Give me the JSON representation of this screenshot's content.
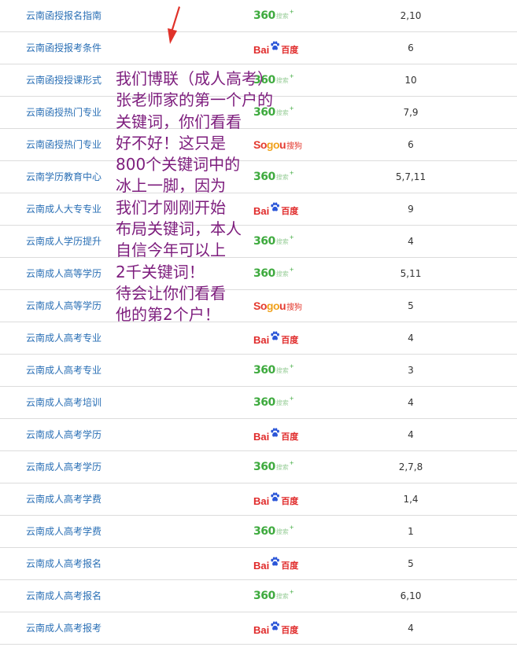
{
  "rows": [
    {
      "keyword": "云南函授报名指南",
      "engine": "360",
      "rank": "2,10"
    },
    {
      "keyword": "云南函授报考条件",
      "engine": "baidu",
      "rank": "6"
    },
    {
      "keyword": "云南函授授课形式",
      "engine": "360",
      "rank": "10"
    },
    {
      "keyword": "云南函授热门专业",
      "engine": "360",
      "rank": "7,9"
    },
    {
      "keyword": "云南函授热门专业",
      "engine": "sogou",
      "rank": "6"
    },
    {
      "keyword": "云南学历教育中心",
      "engine": "360",
      "rank": "5,7,11"
    },
    {
      "keyword": "云南成人大专专业",
      "engine": "baidu",
      "rank": "9"
    },
    {
      "keyword": "云南成人学历提升",
      "engine": "360",
      "rank": "4"
    },
    {
      "keyword": "云南成人高等学历",
      "engine": "360",
      "rank": "5,11"
    },
    {
      "keyword": "云南成人高等学历",
      "engine": "sogou",
      "rank": "5"
    },
    {
      "keyword": "云南成人高考专业",
      "engine": "baidu",
      "rank": "4"
    },
    {
      "keyword": "云南成人高考专业",
      "engine": "360",
      "rank": "3"
    },
    {
      "keyword": "云南成人高考培训",
      "engine": "360",
      "rank": "4"
    },
    {
      "keyword": "云南成人高考学历",
      "engine": "baidu",
      "rank": "4"
    },
    {
      "keyword": "云南成人高考学历",
      "engine": "360",
      "rank": "2,7,8"
    },
    {
      "keyword": "云南成人高考学费",
      "engine": "baidu",
      "rank": "1,4"
    },
    {
      "keyword": "云南成人高考学费",
      "engine": "360",
      "rank": "1"
    },
    {
      "keyword": "云南成人高考报名",
      "engine": "baidu",
      "rank": "5"
    },
    {
      "keyword": "云南成人高考报名",
      "engine": "360",
      "rank": "6,10"
    },
    {
      "keyword": "云南成人高考报考",
      "engine": "baidu",
      "rank": "4"
    }
  ],
  "logos": {
    "360": {
      "num": "360",
      "word": "搜索",
      "star": "+"
    },
    "baidu": {
      "latin": "Bai",
      "cn": "百度"
    },
    "sogou": {
      "s1": "So",
      "s2": "go",
      "s3": "u",
      "cn": "搜狗"
    }
  },
  "annotation": {
    "lines": [
      "我们博联（成人高考）",
      "张老师家的第一个户的",
      "关键词，你们看看",
      "好不好！这只是",
      "800个关键词中的",
      "冰上一脚，因为",
      "我们才刚刚开始",
      "布局关键词，本人",
      "自信今年可以上",
      "2千关键词！",
      "待会让你们看看",
      "他的第2个户！"
    ],
    "color": "#7d1d7d"
  },
  "colors": {
    "keyword_link": "#2a6fb5",
    "row_divider": "#dcdcdc",
    "arrow": "#e0322a",
    "logo_360": "#3eaa3e",
    "logo_baidu": "#e02a2a",
    "logo_sogou_red": "#e43a2f",
    "logo_sogou_orange": "#f0a11b"
  }
}
